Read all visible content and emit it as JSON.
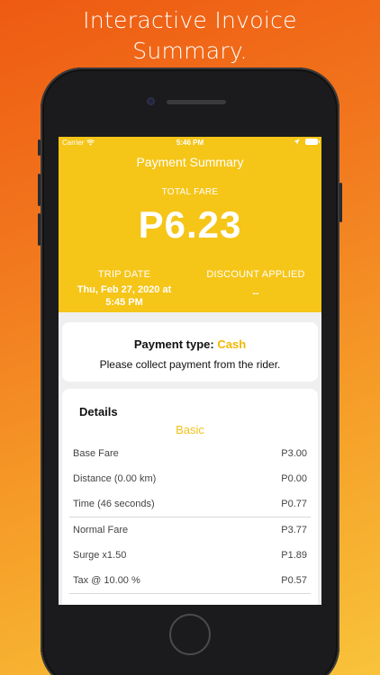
{
  "promo": {
    "headline_line1": "Interactive Invoice",
    "headline_line2": "Summary."
  },
  "status_bar": {
    "carrier": "Carrier",
    "time": "5:46 PM"
  },
  "header": {
    "title": "Payment Summary",
    "total_fare_label": "TOTAL FARE",
    "total_fare": "P6.23",
    "trip_date_label": "TRIP DATE",
    "trip_date_line1": "Thu, Feb 27, 2020 at",
    "trip_date_line2": "5:45 PM",
    "discount_label": "DISCOUNT APPLIED",
    "discount_value": "--"
  },
  "payment": {
    "type_label": "Payment type: ",
    "type_value": "Cash",
    "note": "Please collect payment from the rider."
  },
  "details": {
    "title": "Details",
    "subtitle": "Basic",
    "rows": [
      {
        "label": "Base Fare",
        "value": "P3.00"
      },
      {
        "label": "Distance (0.00 km)",
        "value": "P0.00"
      },
      {
        "label": "Time (46 seconds)",
        "value": "P0.77"
      },
      {
        "label": "Normal Fare",
        "value": "P3.77"
      },
      {
        "label": "Surge x1.50",
        "value": "P1.89"
      },
      {
        "label": "Tax @ 10.00 %",
        "value": "P0.57"
      }
    ]
  },
  "colors": {
    "accent": "#f5c518",
    "cash": "#f0b800",
    "background_top": "#ee5a12",
    "background_bottom": "#f8c33a"
  },
  "icons": [
    "wifi-icon",
    "location-arrow-icon",
    "battery-icon"
  ]
}
